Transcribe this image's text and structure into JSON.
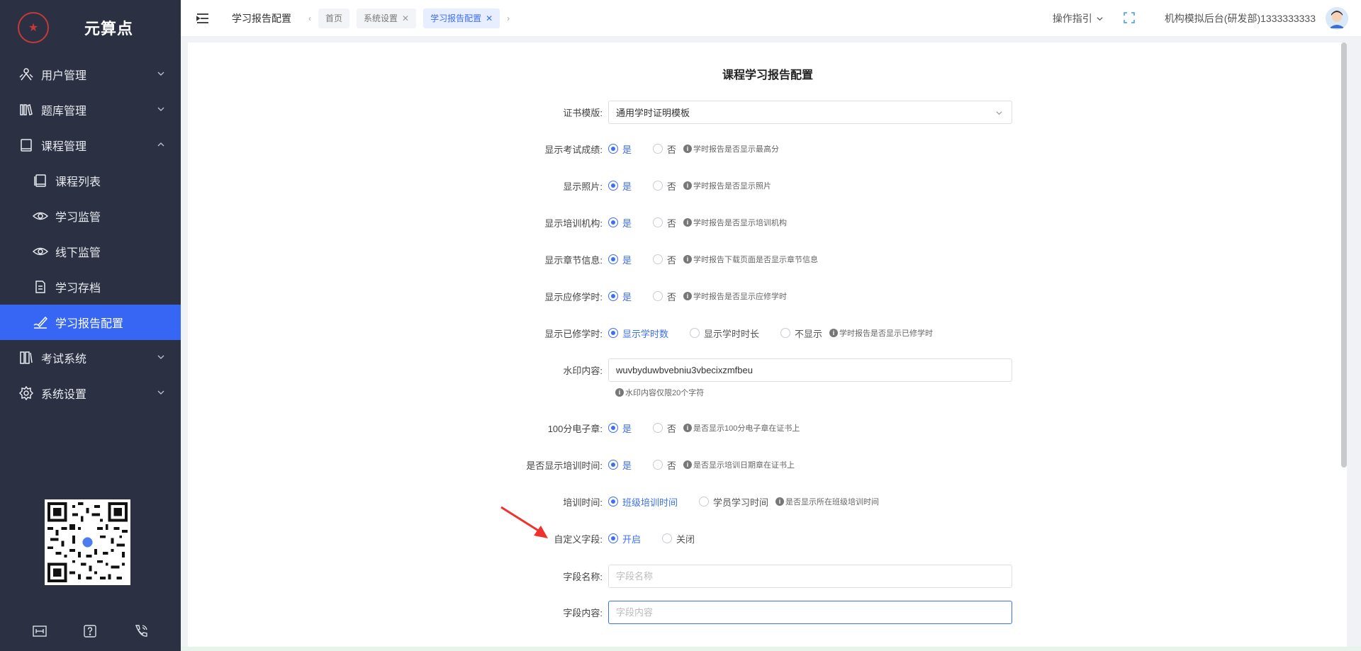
{
  "app": {
    "name": "元算点"
  },
  "sidebar": {
    "items": [
      {
        "label": "用户管理",
        "icon": "users-icon",
        "expanded": false
      },
      {
        "label": "题库管理",
        "icon": "library-icon",
        "expanded": false
      },
      {
        "label": "课程管理",
        "icon": "book-icon",
        "expanded": true
      }
    ],
    "sub_items": [
      {
        "label": "课程列表",
        "icon": "book-list-icon"
      },
      {
        "label": "学习监管",
        "icon": "eye-icon"
      },
      {
        "label": "线下监管",
        "icon": "eye-icon"
      },
      {
        "label": "学习存档",
        "icon": "document-icon"
      },
      {
        "label": "学习报告配置",
        "icon": "pen-icon",
        "active": true
      }
    ],
    "more_items": [
      {
        "label": "考试系统",
        "icon": "exam-icon"
      },
      {
        "label": "系统设置",
        "icon": "gear-icon"
      }
    ],
    "footer_icons": [
      "ruler-icon",
      "help-icon",
      "phone-icon"
    ]
  },
  "header": {
    "page_title": "学习报告配置",
    "tabs": [
      {
        "label": "首页",
        "closable": false,
        "active": false
      },
      {
        "label": "系统设置",
        "closable": true,
        "active": false
      },
      {
        "label": "学习报告配置",
        "closable": true,
        "active": true
      }
    ],
    "guide_label": "操作指引",
    "user_label": "机构模拟后台(研发部)1333333333"
  },
  "form": {
    "title": "课程学习报告配置",
    "template_label": "证书模版:",
    "template_value": "通用学时证明模板",
    "show_exam_label": "显示考试成绩:",
    "show_exam_hint": "学时报告是否显示最高分",
    "show_photo_label": "显示照片:",
    "show_photo_hint": "学时报告是否显示照片",
    "show_org_label": "显示培训机构:",
    "show_org_hint": "学时报告是否显示培训机构",
    "show_chapter_label": "显示章节信息:",
    "show_chapter_hint": "学时报告下载页面是否显示章节信息",
    "show_required_label": "显示应修学时:",
    "show_required_hint": "学时报告是否显示应修学时",
    "show_done_label": "显示已修学时:",
    "show_done_opt1": "显示学时数",
    "show_done_opt2": "显示学时时长",
    "show_done_opt3": "不显示",
    "show_done_hint": "学时报告是否显示已修学时",
    "watermark_label": "水印内容:",
    "watermark_value": "wuvbyduwbvebniu3vbecixzmfbeu",
    "watermark_hint": "水印内容仅限20个字符",
    "seal_label": "100分电子章:",
    "seal_hint": "是否显示100分电子章在证书上",
    "show_time_label": "是否显示培训时间:",
    "show_time_hint": "是否显示培训日期章在证书上",
    "train_time_label": "培训时间:",
    "train_time_opt1": "班级培训时间",
    "train_time_opt2": "学员学习时间",
    "train_time_hint": "是否显示所在班级培训时间",
    "custom_label": "自定义字段:",
    "custom_on": "开启",
    "custom_off": "关闭",
    "field_name_label": "字段名称:",
    "field_name_placeholder": "字段名称",
    "field_content_label": "字段内容:",
    "field_content_placeholder": "字段内容",
    "yes": "是",
    "no": "否"
  },
  "colors": {
    "sidebar_bg": "#2b3142",
    "accent": "#3d6ef5",
    "active_menu": "#3766f4",
    "arrow": "#f0312d"
  }
}
